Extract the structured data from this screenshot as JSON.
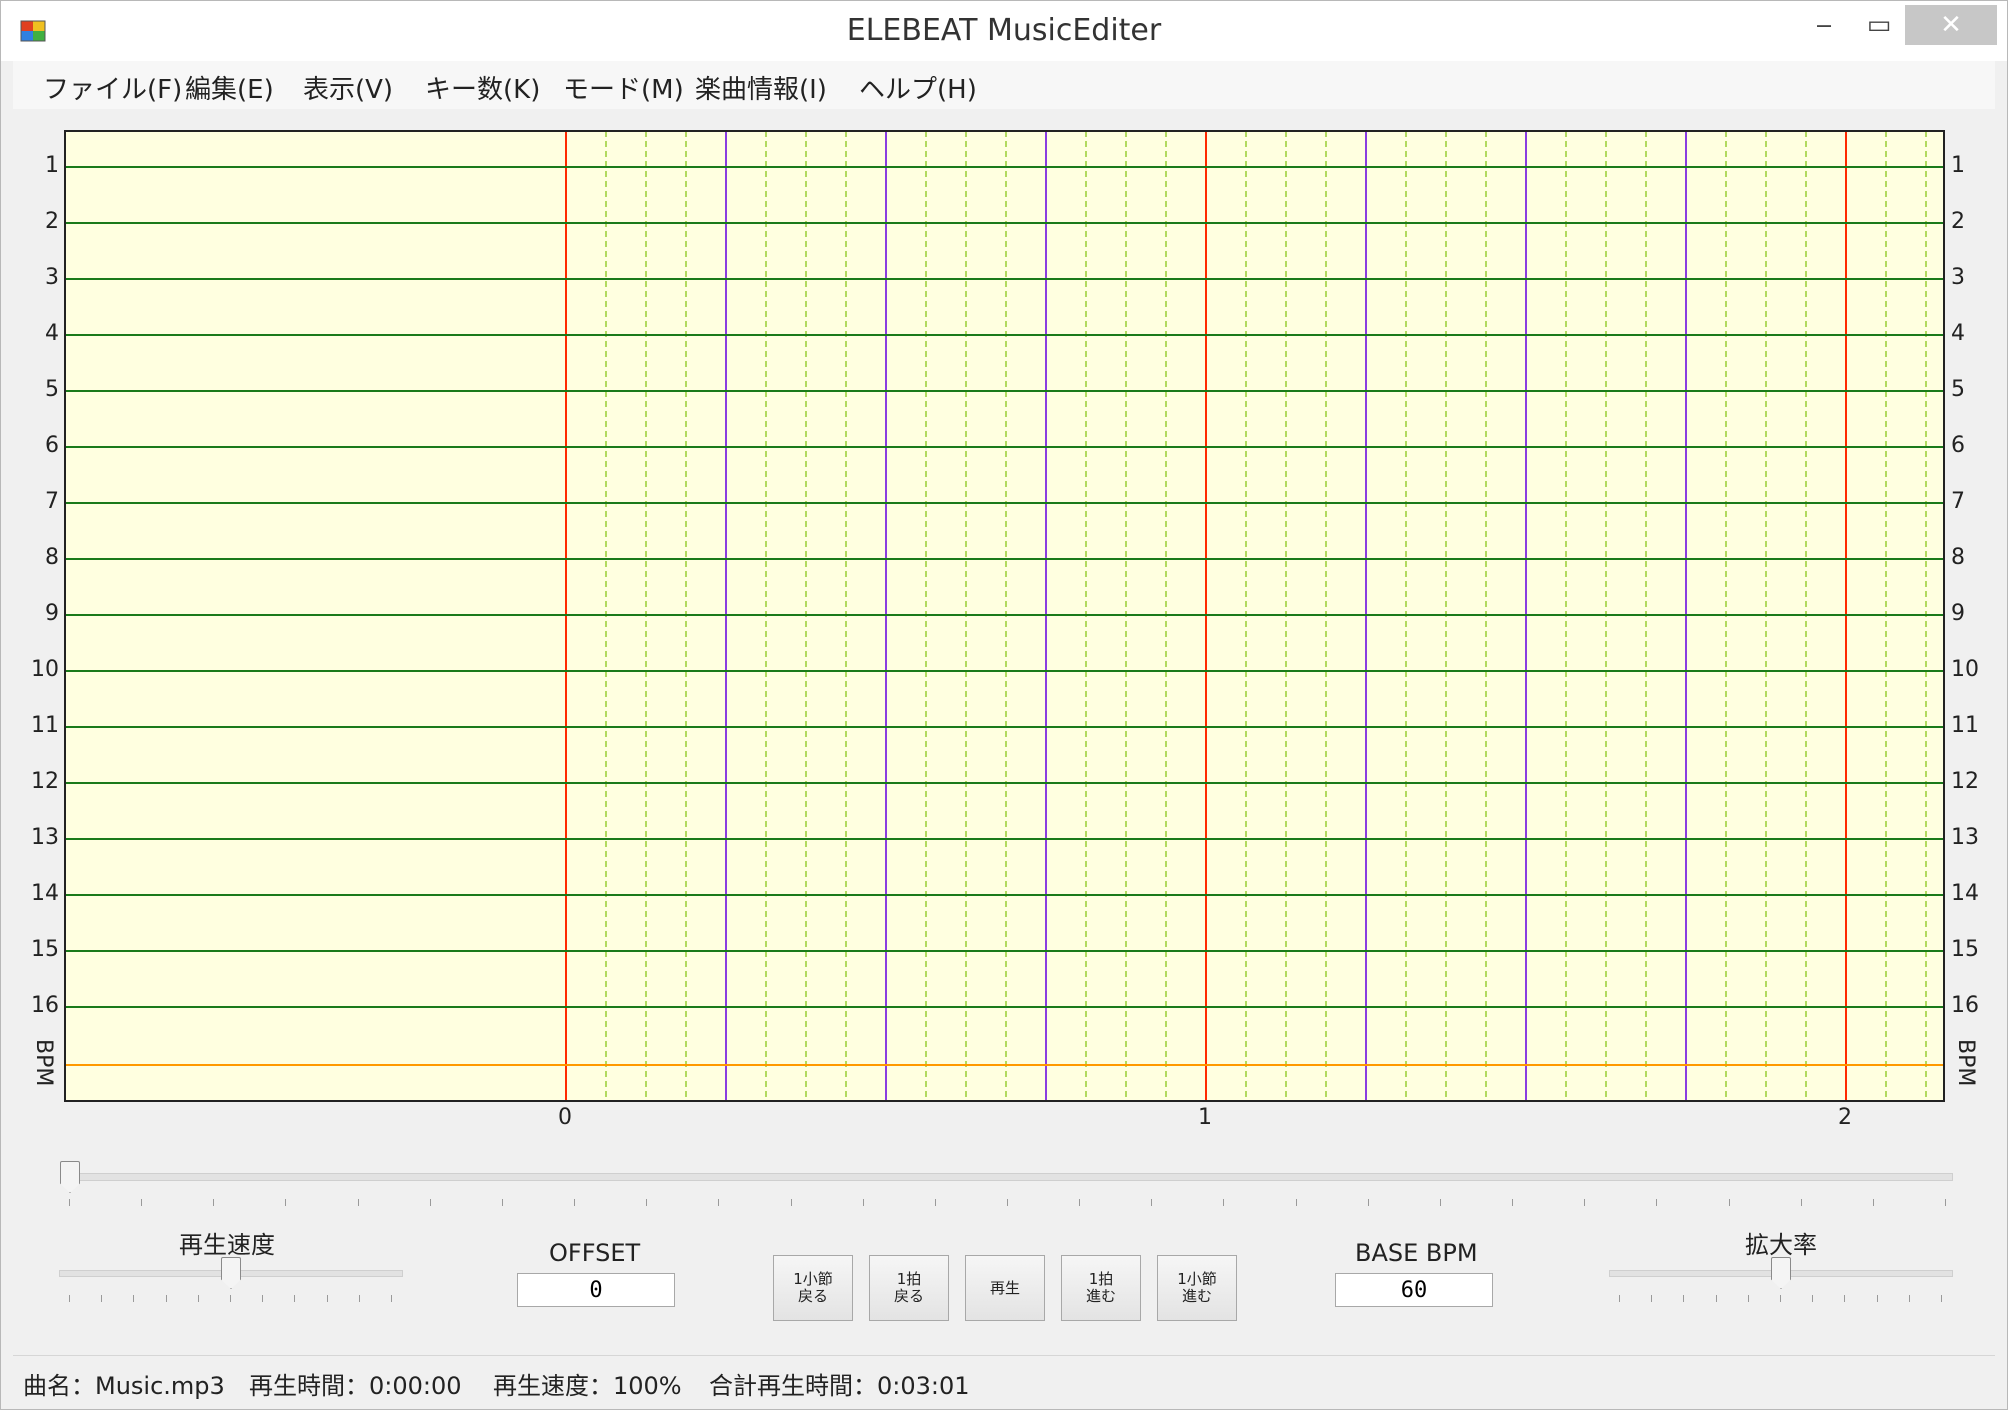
{
  "window": {
    "title": "ELEBEAT MusicEditer",
    "minimize_glyph": "‒",
    "maximize_glyph": "▭",
    "close_glyph": "✕"
  },
  "menu": [
    "ファイル(F)",
    "編集(E)",
    "表示(V)",
    "キー数(K)",
    "モード(M)",
    "楽曲情報(I)",
    "ヘルプ(H)"
  ],
  "grid": {
    "row_labels": [
      "1",
      "2",
      "3",
      "4",
      "5",
      "6",
      "7",
      "8",
      "9",
      "10",
      "11",
      "12",
      "13",
      "14",
      "15",
      "16"
    ],
    "bpm_label": "BPM",
    "measure_labels": [
      "0",
      "1",
      "2"
    ],
    "colors": {
      "background": "#ffffe0",
      "row_line": "#1a7a1a",
      "measure_line": "#ff2a00",
      "beat_line": "#8a3de0",
      "sub_line": "#88c61a",
      "bpm_line": "#ff9900",
      "border": "#222222"
    }
  },
  "controls": {
    "speed_label": "再生速度",
    "speed_position": 0.5,
    "offset_label": "OFFSET",
    "offset_value": "0",
    "base_bpm_label": "BASE BPM",
    "base_bpm_value": "60",
    "zoom_label": "拡大率",
    "zoom_position": 0.5,
    "timeline_position": 0.0,
    "buttons": {
      "prev_measure": "1小節\n戻る",
      "prev_beat": "1拍\n戻る",
      "play": "再生",
      "next_beat": "1拍\n進む",
      "next_measure": "1小節\n進む"
    }
  },
  "status": {
    "song": "曲名：Music.mp3",
    "play_time": "再生時間：0:00:00",
    "play_speed": "再生速度：100%",
    "total_time": "合計再生時間：0:03:01"
  }
}
